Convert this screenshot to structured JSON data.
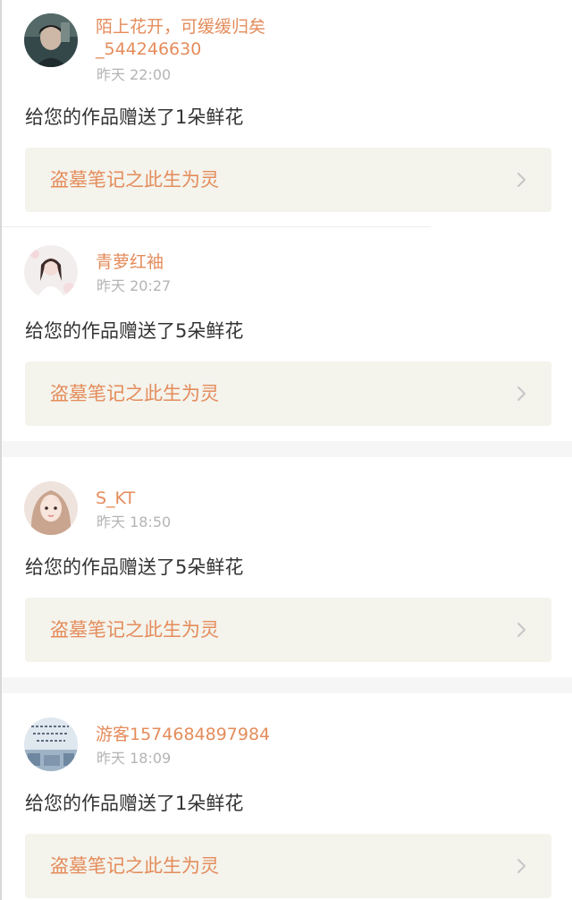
{
  "colors": {
    "accent": "#e48c5b",
    "card_bg": "#f4f3ec",
    "time_gray": "#b4b4b4",
    "text_dark": "#333333"
  },
  "icons": {
    "card_arrow": "chevron-right-icon"
  },
  "notifications": [
    {
      "username": "陌上花开，可缓缓归矣\n_544246630",
      "time": "昨天 22:00",
      "message": "给您的作品赠送了1朵鲜花",
      "work_title": "盗墓笔记之此生为灵"
    },
    {
      "username": "青萝红袖",
      "time": "昨天 20:27",
      "message": "给您的作品赠送了5朵鲜花",
      "work_title": "盗墓笔记之此生为灵"
    },
    {
      "username": "S_KT",
      "time": "昨天 18:50",
      "message": "给您的作品赠送了5朵鲜花",
      "work_title": "盗墓笔记之此生为灵"
    },
    {
      "username": "游客1574684897984",
      "time": "昨天 18:09",
      "message": "给您的作品赠送了1朵鲜花",
      "work_title": "盗墓笔记之此生为灵"
    }
  ]
}
